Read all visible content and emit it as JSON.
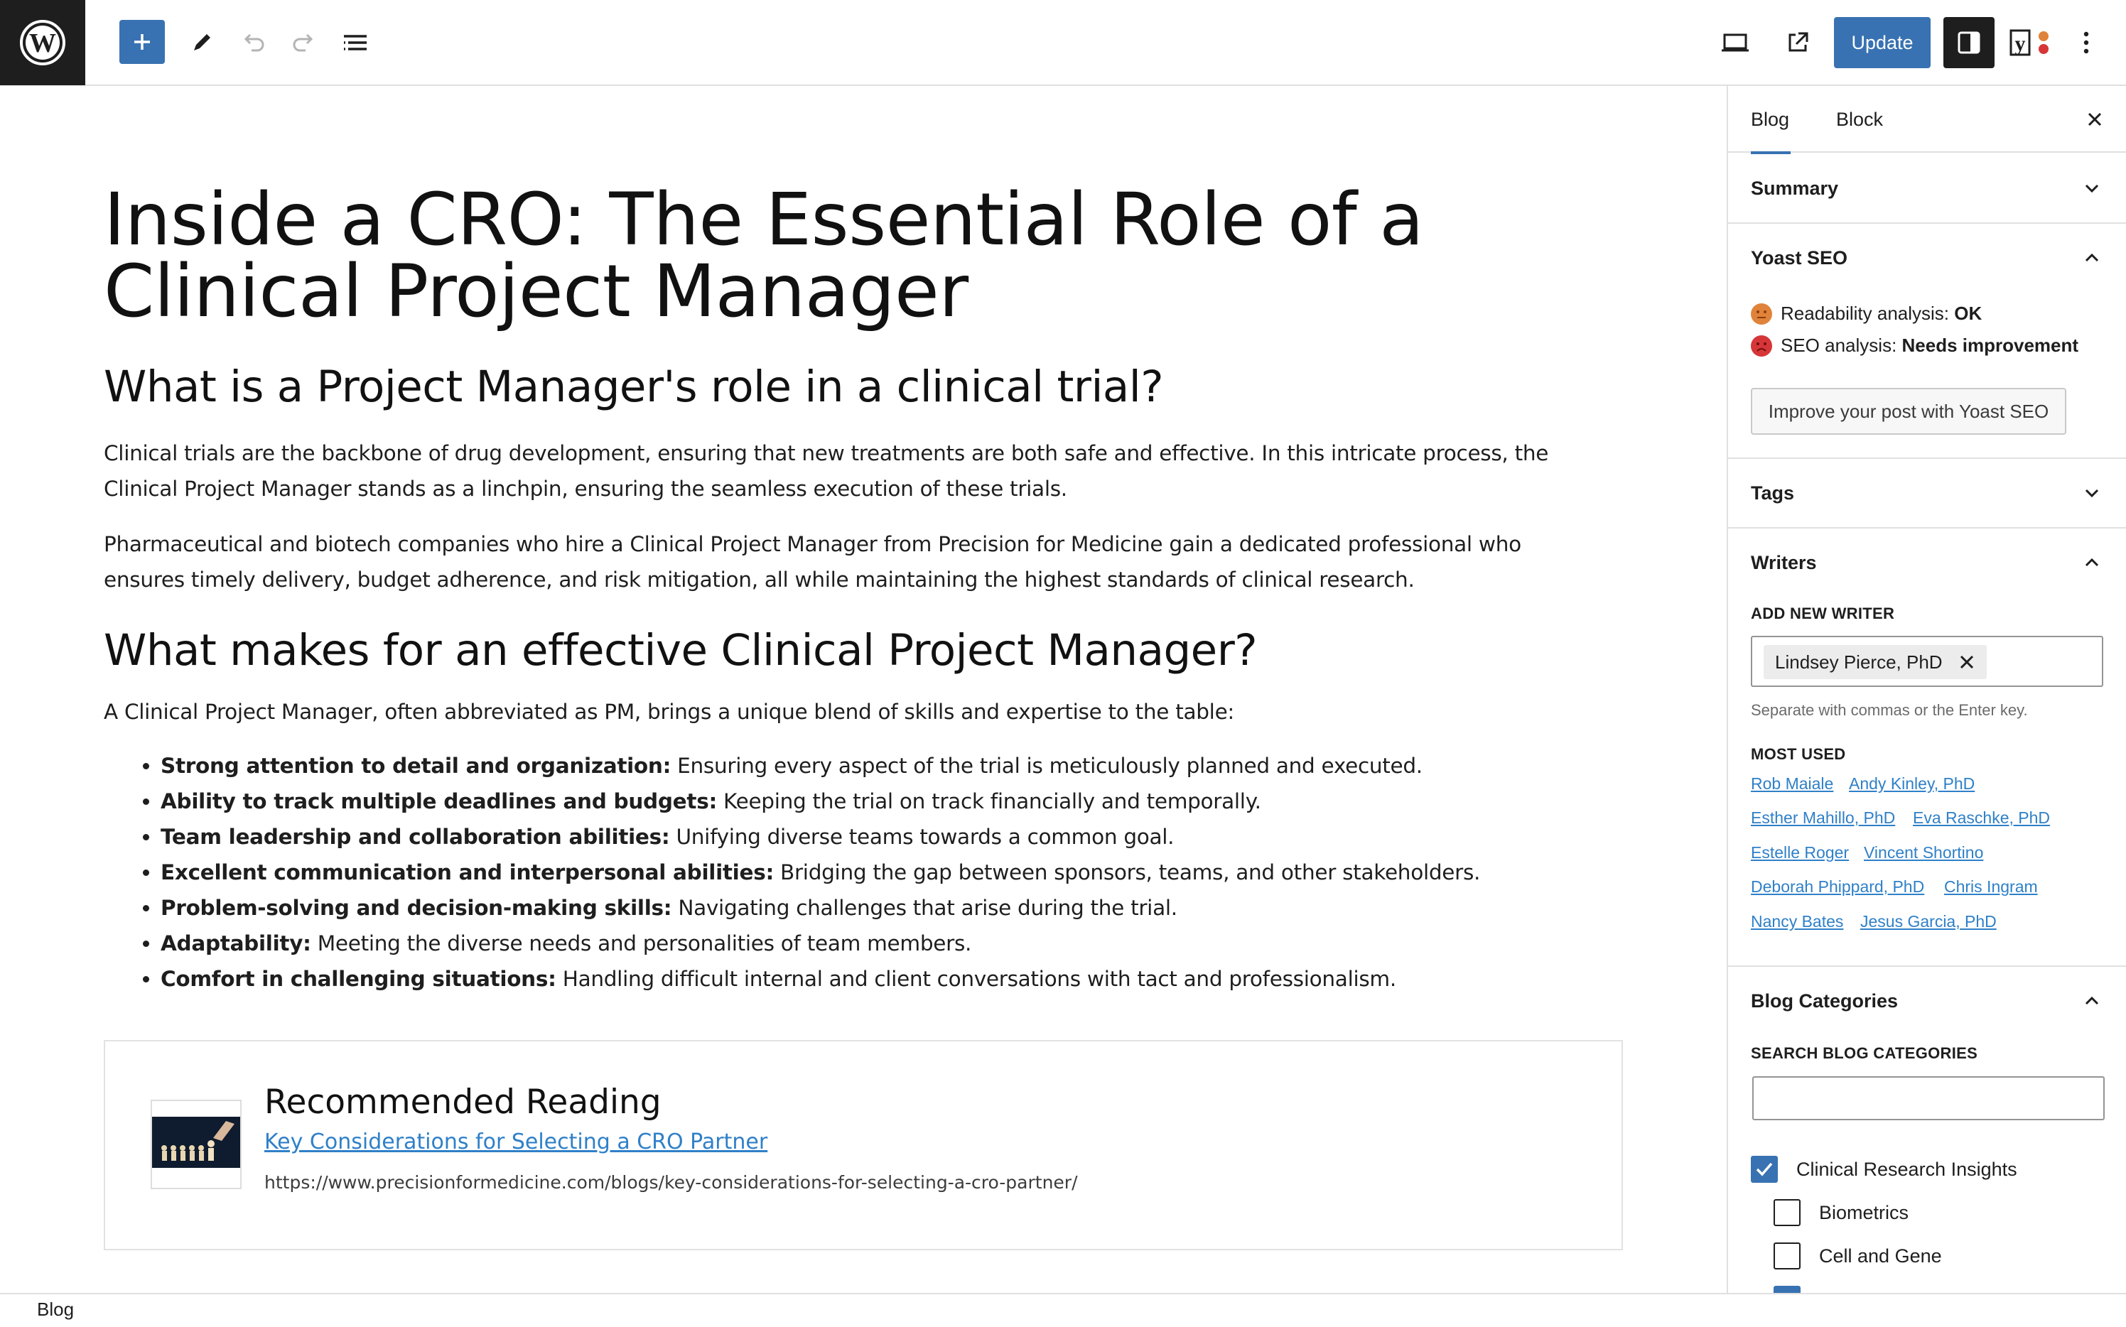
{
  "toolbar": {
    "update_label": "Update",
    "icons": [
      "wordpress-logo",
      "add-block-icon",
      "pencil-icon",
      "undo-icon",
      "redo-icon",
      "list-view-icon",
      "desktop-preview-icon",
      "external-view-icon",
      "settings-icon",
      "yoast-icon",
      "more-options-icon"
    ]
  },
  "post": {
    "title": "Inside a CRO: The Essential Role of a Clinical Project Manager",
    "h2_1": "What is a Project Manager's role in a clinical trial?",
    "p1": "Clinical trials are the backbone of drug development, ensuring that new treatments are both safe and effective. In this intricate process, the Clinical Project Manager stands as a linchpin, ensuring the seamless execution of these trials.",
    "p2": "Pharmaceutical and biotech companies who hire a Clinical Project Manager from Precision for Medicine gain a dedicated professional who ensures timely delivery, budget adherence, and risk mitigation, all while maintaining the highest standards of clinical research.",
    "h2_2": "What makes for an effective Clinical Project Manager?",
    "p3": "A Clinical Project Manager, often abbreviated as PM, brings a unique blend of skills and expertise to the table:",
    "skills": [
      {
        "bold": "Strong attention to detail and organization:",
        "text": " Ensuring every aspect of the trial is meticulously planned and executed."
      },
      {
        "bold": "Ability to track multiple deadlines and budgets:",
        "text": " Keeping the trial on track financially and temporally."
      },
      {
        "bold": "Team leadership and collaboration abilities:",
        "text": " Unifying diverse teams towards a common goal."
      },
      {
        "bold": "Excellent communication and interpersonal abilities:",
        "text": " Bridging the gap between sponsors, teams, and other stakeholders."
      },
      {
        "bold": "Problem-solving and decision-making skills:",
        "text": " Navigating challenges that arise during the trial."
      },
      {
        "bold": "Adaptability:",
        "text": " Meeting the diverse needs and personalities of team members."
      },
      {
        "bold": "Comfort in challenging situations:",
        "text": " Handling difficult internal and client conversations with tact and professionalism."
      }
    ],
    "recommended": {
      "heading": "Recommended Reading",
      "link_text": "Key Considerations for Selecting a CRO Partner",
      "url": "https://www.precisionformedicine.com/blogs/key-considerations-for-selecting-a-cro-partner/"
    }
  },
  "footer": {
    "breadcrumb": "Blog"
  },
  "sidebar": {
    "tabs": [
      "Blog",
      "Block"
    ],
    "summary": "Summary",
    "yoast": {
      "title": "Yoast SEO",
      "readability_label": "Readability analysis: ",
      "readability_value": "OK",
      "seo_label": "SEO analysis: ",
      "seo_value": "Needs improvement",
      "improve_button": "Improve your post with Yoast SEO"
    },
    "tags": "Tags",
    "writers": {
      "title": "Writers",
      "add_label": "ADD NEW WRITER",
      "current": "Lindsey Pierce, PhD",
      "help": "Separate with commas or the Enter key.",
      "most_used_label": "MOST USED",
      "most_used": [
        [
          "Rob Maiale",
          "Andy Kinley, PhD"
        ],
        [
          "Esther Mahillo, PhD",
          "Eva Raschke, PhD"
        ],
        [
          "Estelle Roger",
          "Vincent Shortino"
        ],
        [
          "Deborah Phippard, PhD",
          "Chris Ingram"
        ],
        [
          "Nancy Bates",
          "Jesus Garcia, PhD"
        ]
      ]
    },
    "categories": {
      "title": "Blog Categories",
      "search_label": "SEARCH BLOG CATEGORIES",
      "items": [
        {
          "label": "Clinical Research Insights",
          "checked": true
        },
        {
          "label": "Biometrics",
          "checked": false
        },
        {
          "label": "Cell and Gene",
          "checked": false
        }
      ]
    }
  },
  "colors": {
    "accent": "#3872b2",
    "link": "#2f80c8",
    "ok_face": "#e0833a",
    "bad_face": "#d63638"
  }
}
